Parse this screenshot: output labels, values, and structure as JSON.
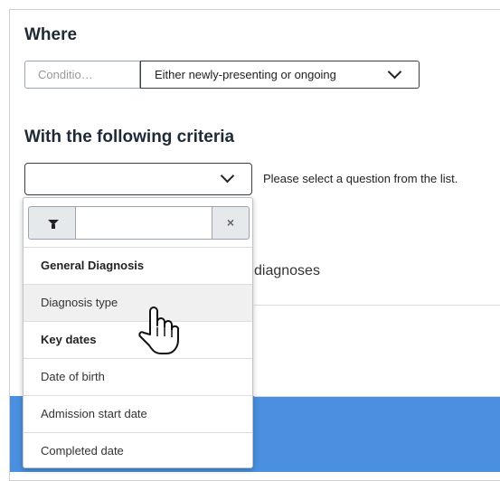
{
  "where": {
    "heading": "Where",
    "condition_placeholder": "Conditio…",
    "status_value": "Either newly-presenting or ongoing"
  },
  "criteria": {
    "heading": "With the following criteria",
    "select_value": "",
    "hint": "Please select a question from the list."
  },
  "dropdown": {
    "filter_icon": "filter-icon",
    "filter_value": "",
    "clear_label": "×",
    "options": [
      {
        "label": "General Diagnosis",
        "kind": "group"
      },
      {
        "label": "Diagnosis type",
        "kind": "option",
        "hovered": true
      },
      {
        "label": "Key dates",
        "kind": "group"
      },
      {
        "label": "Date of birth",
        "kind": "option"
      },
      {
        "label": "Admission start date",
        "kind": "option"
      },
      {
        "label": "Completed date",
        "kind": "option"
      }
    ]
  },
  "background": {
    "partial_text": "diagnoses"
  },
  "colors": {
    "accent_band": "#4a8fe0",
    "hover_row": "#f0f0f0"
  },
  "cursor": "hand-pointer-icon"
}
